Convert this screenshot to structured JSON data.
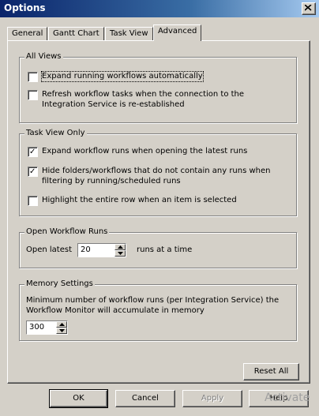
{
  "window": {
    "title": "Options"
  },
  "tabs": [
    {
      "label": "General"
    },
    {
      "label": "Gantt Chart"
    },
    {
      "label": "Task View"
    },
    {
      "label": "Advanced"
    }
  ],
  "all_views": {
    "legend": "All Views",
    "opt1": {
      "label": "Expand running workflows automatically",
      "checked": false
    },
    "opt2": {
      "line1": "Refresh workflow tasks when the connection to the",
      "line2": "Integration Service is re-established",
      "checked": false
    }
  },
  "task_view_only": {
    "legend": "Task View Only",
    "opt1": {
      "label": "Expand workflow runs when opening the latest runs",
      "checked": true
    },
    "opt2": {
      "line1": "Hide folders/workflows that do not contain any runs when",
      "line2": "filtering by running/scheduled runs",
      "checked": true
    },
    "opt3": {
      "label": "Highlight the entire row when an item is selected",
      "checked": false
    }
  },
  "open_runs": {
    "legend": "Open Workflow Runs",
    "prefix": "Open latest",
    "value": "20",
    "suffix": "runs at a time"
  },
  "memory": {
    "legend": "Memory Settings",
    "line1": "Minimum number of workflow runs (per Integration Service) the",
    "line2": "Workflow Monitor will accumulate in memory",
    "value": "300"
  },
  "buttons": {
    "reset_all": "Reset All",
    "ok": "OK",
    "cancel": "Cancel",
    "apply": "Apply",
    "help": "Help"
  },
  "watermark": "Activate"
}
